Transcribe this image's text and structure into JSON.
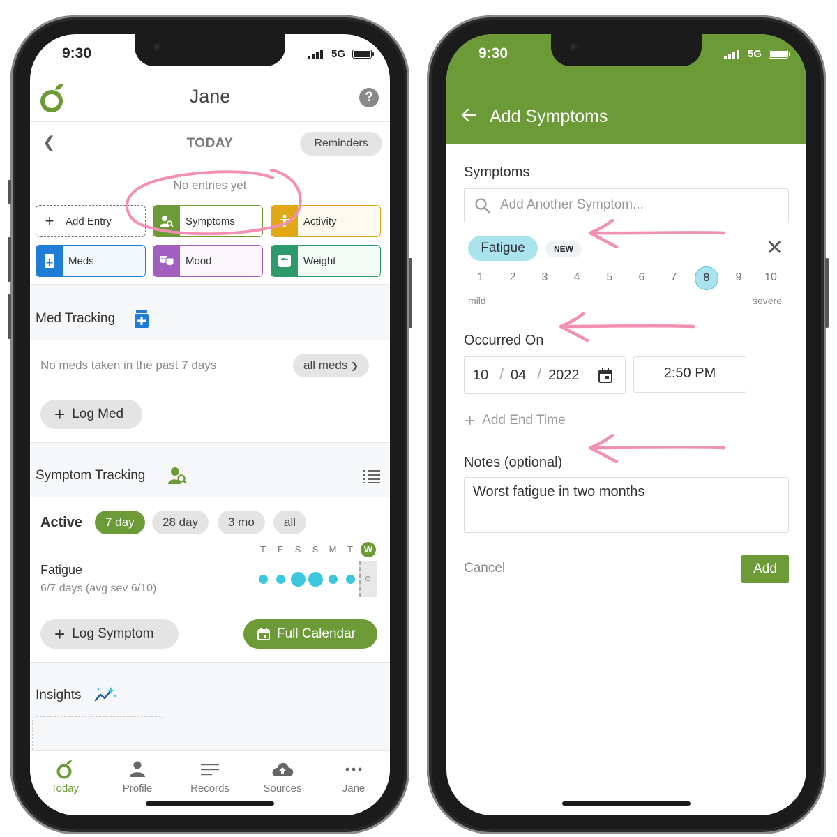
{
  "left_phone": {
    "status": {
      "time": "9:30",
      "network": "5G"
    },
    "header": {
      "title": "Jane",
      "help_icon": "?"
    },
    "day_nav": {
      "label": "TODAY",
      "reminders_label": "Reminders",
      "empty_text": "No entries yet"
    },
    "entry_buttons": [
      {
        "label": "Add Entry",
        "icon": "plus-icon",
        "color": "#777777"
      },
      {
        "label": "Symptoms",
        "icon": "person-search-icon",
        "color": "#6c9a37"
      },
      {
        "label": "Activity",
        "icon": "activity-icon",
        "color": "#e1a815"
      },
      {
        "label": "Meds",
        "icon": "med-bottle-icon",
        "color": "#1f7dd8"
      },
      {
        "label": "Mood",
        "icon": "theater-masks-icon",
        "color": "#a35fc0"
      },
      {
        "label": "Weight",
        "icon": "scale-icon",
        "color": "#2e9a6b"
      }
    ],
    "med_tracking": {
      "title": "Med Tracking",
      "empty_text": "No meds taken in the past 7 days",
      "all_meds_label": "all meds",
      "log_med_label": "Log Med"
    },
    "symptom_tracking": {
      "title": "Symptom Tracking",
      "active_label": "Active",
      "ranges": [
        "7 day",
        "28 day",
        "3 mo",
        "all"
      ],
      "selected_range": "7 day",
      "weekdays": [
        "T",
        "F",
        "S",
        "S",
        "M",
        "T",
        "W"
      ],
      "symptom_name": "Fatigue",
      "symptom_summary": "6/7 days (avg sev 6/10)",
      "log_symptom_label": "Log Symptom",
      "full_calendar_label": "Full Calendar"
    },
    "insights": {
      "title": "Insights"
    },
    "tabs": [
      {
        "label": "Today",
        "icon": "leaf-logo-icon",
        "active": true
      },
      {
        "label": "Profile",
        "icon": "person-icon",
        "active": false
      },
      {
        "label": "Records",
        "icon": "list-lines-icon",
        "active": false
      },
      {
        "label": "Sources",
        "icon": "cloud-upload-icon",
        "active": false
      },
      {
        "label": "Jane",
        "icon": "more-dots-icon",
        "active": false
      }
    ]
  },
  "right_phone": {
    "status": {
      "time": "9:30",
      "network": "5G"
    },
    "header": {
      "title": "Add Symptoms"
    },
    "symptoms_label": "Symptoms",
    "search_placeholder": "Add Another Symptom...",
    "symptom_chip": "Fatigue",
    "new_badge": "NEW",
    "severity": {
      "values": [
        "1",
        "2",
        "3",
        "4",
        "5",
        "6",
        "7",
        "8",
        "9",
        "10"
      ],
      "selected": "8",
      "min_label": "mild",
      "max_label": "severe"
    },
    "occurred_on_label": "Occurred On",
    "date": {
      "month": "10",
      "day": "04",
      "year": "2022"
    },
    "time_value": "2:50 PM",
    "add_end_time_label": "Add End Time",
    "notes_label": "Notes (optional)",
    "notes_value": "Worst fatigue in two months",
    "cancel_label": "Cancel",
    "add_label": "Add"
  },
  "colors": {
    "brand_green": "#6c9a37",
    "dot_blue": "#3bc7e0",
    "annotation_pink": "#f38fb3"
  }
}
